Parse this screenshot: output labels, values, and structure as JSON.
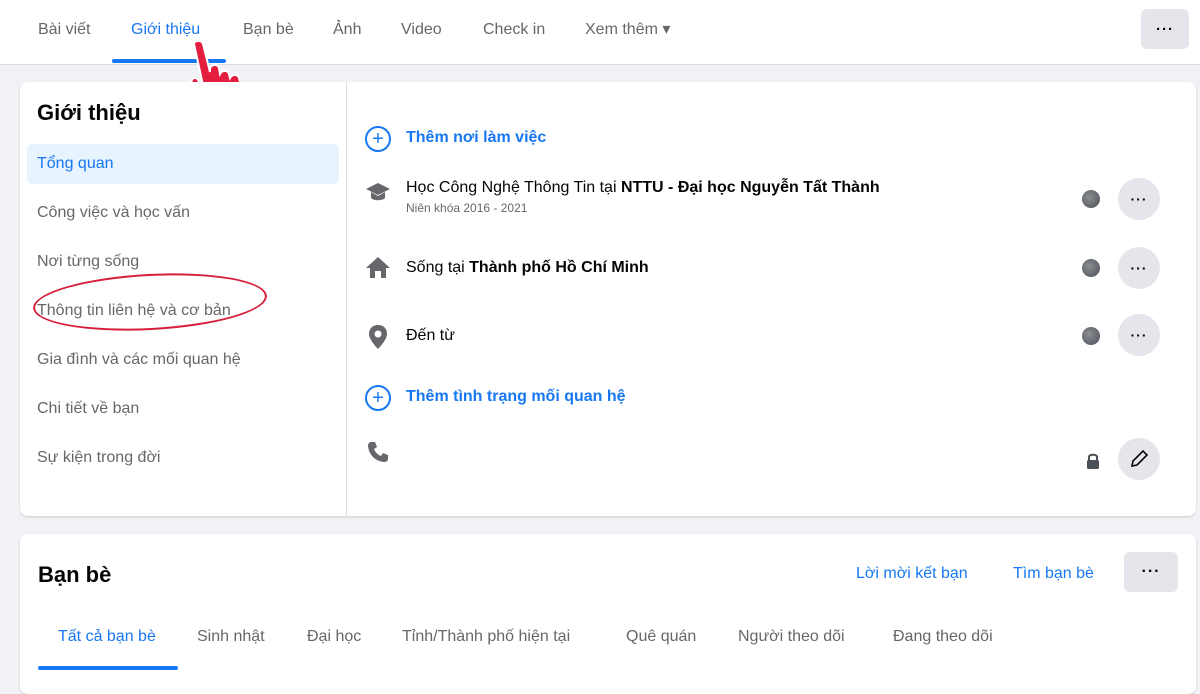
{
  "tabs": [
    {
      "label": "Bài viết"
    },
    {
      "label": "Giới thiệu"
    },
    {
      "label": "Bạn bè"
    },
    {
      "label": "Ảnh"
    },
    {
      "label": "Video"
    },
    {
      "label": "Check in"
    },
    {
      "label": "Xem thêm ▾"
    }
  ],
  "top_more_label": "···",
  "intro": {
    "title": "Giới thiệu",
    "sidebar": [
      {
        "label": "Tổng quan",
        "active": true
      },
      {
        "label": "Công việc và học vấn"
      },
      {
        "label": "Nơi từng sống"
      },
      {
        "label": "Thông tin liên hệ và cơ bản"
      },
      {
        "label": "Gia đình và các mối quan hệ"
      },
      {
        "label": "Chi tiết về bạn"
      },
      {
        "label": "Sự kiện trong đời"
      }
    ],
    "add_work": "Thêm nơi làm việc",
    "education_prefix": "Học Công Nghệ Thông Tin tại ",
    "education_school": "NTTU - Đại học Nguyễn Tất Thành",
    "education_years": "Niên khóa 2016 - 2021",
    "lives_prefix": "Sống tại ",
    "lives_place": "Thành phố Hồ Chí Minh",
    "from_label": "Đến từ",
    "add_relationship": "Thêm tình trạng mối quan hệ",
    "more_label": "···",
    "icons": {
      "add": "plus-circle-icon",
      "education": "graduation-cap-icon",
      "home": "home-icon",
      "location": "map-pin-icon",
      "phone": "phone-icon",
      "privacy_public": "globe-icon",
      "privacy_private": "lock-icon",
      "edit": "pencil-icon"
    }
  },
  "friends": {
    "title": "Bạn bè",
    "requests_link": "Lời mời kết bạn",
    "find_link": "Tìm bạn bè",
    "more_label": "···",
    "tabs": [
      {
        "label": "Tất cả bạn bè",
        "active": true
      },
      {
        "label": "Sinh nhật"
      },
      {
        "label": "Đại học"
      },
      {
        "label": "Tỉnh/Thành phố hiện tại"
      },
      {
        "label": "Quê quán"
      },
      {
        "label": "Người theo dõi"
      },
      {
        "label": "Đang theo dõi"
      }
    ]
  },
  "colors": {
    "accent": "#1877f2",
    "annotation": "#d61f3c"
  }
}
